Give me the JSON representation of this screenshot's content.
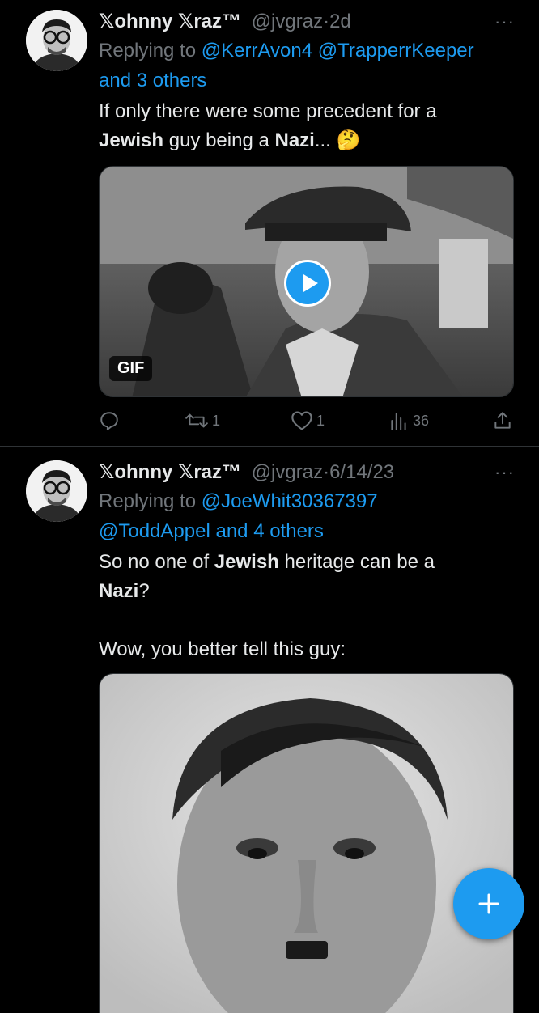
{
  "tweets": [
    {
      "author_name": "𝕏ohnny 𝕏raz™",
      "handle": "@jvgraz",
      "separator": "·",
      "time": "2d",
      "more_label": "···",
      "replying_prefix": "Replying to",
      "reply_mentions": [
        "@KerrAvon4",
        "@TrapperrKeeper"
      ],
      "reply_others": "and 3 others",
      "text_parts": [
        "If only there were some precedent for a",
        "Jewish",
        " guy being a ",
        "Nazi",
        "... 🤔"
      ],
      "media": {
        "type": "gif",
        "badge": "GIF"
      },
      "stats": {
        "replies": "",
        "retweets": "1",
        "likes": "1",
        "views": "36"
      }
    },
    {
      "author_name": "𝕏ohnny 𝕏raz™",
      "handle": "@jvgraz",
      "separator": "·",
      "time": "6/14/23",
      "more_label": "···",
      "replying_prefix": "Replying to",
      "reply_mentions": [
        "@JoeWhit30367397",
        "@ToddAppel"
      ],
      "reply_connector": " and ",
      "reply_others": "4 others",
      "text_parts": [
        "So no one of ",
        "Jewish",
        " heritage can be a",
        "Nazi",
        "?",
        "Wow, you better tell this guy:"
      ],
      "media": {
        "type": "photo"
      }
    }
  ],
  "icons": {
    "reply": "reply-icon",
    "retweet": "retweet-icon",
    "like": "heart-icon",
    "views": "views-icon",
    "share": "share-icon",
    "compose": "plus-icon"
  },
  "colors": {
    "background": "#000000",
    "text": "#e7e9ea",
    "muted": "#71767b",
    "accent": "#1d9bf0"
  }
}
